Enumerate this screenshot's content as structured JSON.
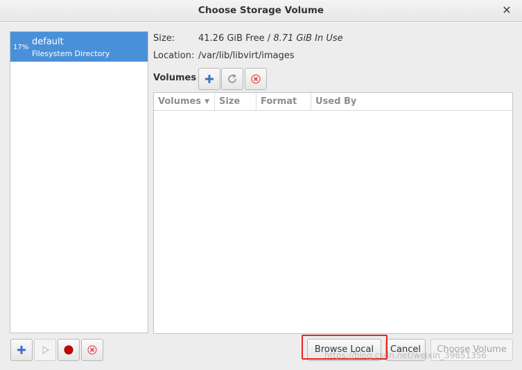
{
  "window": {
    "title": "Choose Storage Volume"
  },
  "pools": [
    {
      "percent": "17%",
      "name": "default",
      "type": "Filesystem Directory"
    }
  ],
  "info": {
    "size_label": "Size:",
    "size_free": "41.26 GiB Free",
    "size_sep": " / ",
    "size_used": "8.71 GiB In Use",
    "location_label": "Location:",
    "location_value": "/var/lib/libvirt/images"
  },
  "volumes": {
    "label": "Volumes",
    "columns": [
      "Volumes",
      "Size",
      "Format",
      "Used By"
    ],
    "rows": []
  },
  "buttons": {
    "browse_local": "Browse Local",
    "cancel": "Cancel",
    "choose_volume": "Choose Volume"
  },
  "watermark": "https://blog.csdn.net/weixin_39651356",
  "colors": {
    "selection": "#4a90d9",
    "add_icon": "#3a6fc4",
    "stop_icon": "#cc0000",
    "delete_icon": "#e04a4a",
    "highlight": "#e8231d"
  }
}
